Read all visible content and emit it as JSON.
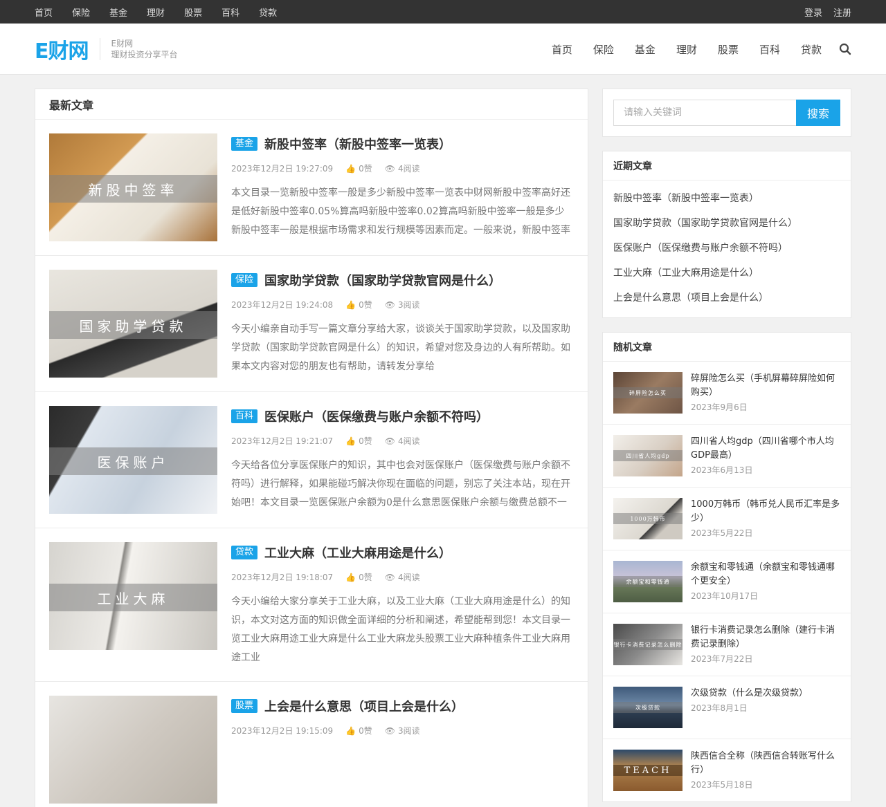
{
  "topbar": {
    "links": [
      "首页",
      "保险",
      "基金",
      "理财",
      "股票",
      "百科",
      "贷款"
    ],
    "login": "登录",
    "register": "注册"
  },
  "header": {
    "logo": "E财网",
    "site_name": "E财网",
    "tagline": "理财投资分享平台",
    "nav": [
      "首页",
      "保险",
      "基金",
      "理财",
      "股票",
      "百科",
      "贷款"
    ],
    "search_icon": "search-icon"
  },
  "main": {
    "heading": "最新文章",
    "posts": [
      {
        "category": "基金",
        "title": "新股中签率（新股中签率一览表）",
        "date": "2023年12月2日 19:27:09",
        "likes": "0赞",
        "views": "4阅读",
        "excerpt": "本文目录一览新股中签率一般是多少新股中签率一览表中财网新股中签率高好还是低好新股中签率0.05%算高吗新股中签率0.02算高吗新股中签率一般是多少新股中签率一般是根据市场需求和发行规模等因素而定。一般来说，新股中签率",
        "thumb_text": "新股中签率"
      },
      {
        "category": "保险",
        "title": "国家助学贷款（国家助学贷款官网是什么）",
        "date": "2023年12月2日 19:24:08",
        "likes": "0赞",
        "views": "3阅读",
        "excerpt": "今天小编亲自动手写一篇文章分享给大家，谈谈关于国家助学贷款，以及国家助学贷款（国家助学贷款官网是什么）的知识，希望对您及身边的人有所帮助。如果本文内容对您的朋友也有帮助，请转发分享给",
        "thumb_text": "国家助学贷款"
      },
      {
        "category": "百科",
        "title": "医保账户（医保缴费与账户余额不符吗）",
        "date": "2023年12月2日 19:21:07",
        "likes": "0赞",
        "views": "4阅读",
        "excerpt": "今天给各位分享医保账户的知识，其中也会对医保账户（医保缴费与账户余额不符吗）进行解释，如果能碰巧解决你现在面临的问题，别忘了关注本站，现在开始吧！本文目录一览医保账户余额为0是什么意思医保账户余额与缴费总额不一",
        "thumb_text": "医保账户"
      },
      {
        "category": "贷款",
        "title": "工业大麻（工业大麻用途是什么）",
        "date": "2023年12月2日 19:18:07",
        "likes": "0赞",
        "views": "4阅读",
        "excerpt": "今天小编给大家分享关于工业大麻，以及工业大麻（工业大麻用途是什么）的知识，本文对这方面的知识做全面详细的分析和阐述，希望能帮到您！本文目录一览工业大麻用途工业大麻是什么工业大麻龙头股票工业大麻种植条件工业大麻用途工业",
        "thumb_text": "工业大麻"
      },
      {
        "category": "股票",
        "title": "上会是什么意思（项目上会是什么）",
        "date": "2023年12月2日 19:15:09",
        "likes": "0赞",
        "views": "3阅读",
        "excerpt": "",
        "thumb_text": ""
      }
    ]
  },
  "sidebar": {
    "search_placeholder": "请输入关键词",
    "search_button": "搜索",
    "recent_heading": "近期文章",
    "recent": [
      "新股中签率（新股中签率一览表）",
      "国家助学贷款（国家助学贷款官网是什么）",
      "医保账户（医保缴费与账户余额不符吗）",
      "工业大麻（工业大麻用途是什么）",
      "上会是什么意思（项目上会是什么）"
    ],
    "random_heading": "随机文章",
    "random": [
      {
        "title": "碎屏险怎么买（手机屏幕碎屏险如何购买）",
        "date": "2023年9月6日",
        "thumb_text": "碎屏险怎么买"
      },
      {
        "title": "四川省人均gdp（四川省哪个市人均GDP最高）",
        "date": "2023年6月13日",
        "thumb_text": "四川省人均gdp"
      },
      {
        "title": "1000万韩币（韩币兑人民币汇率是多少）",
        "date": "2023年5月22日",
        "thumb_text": "1000万韩币"
      },
      {
        "title": "余额宝和零钱通（余额宝和零钱通哪个更安全）",
        "date": "2023年10月17日",
        "thumb_text": "余额宝和零钱通"
      },
      {
        "title": "银行卡消费记录怎么删除（建行卡消费记录删除）",
        "date": "2023年7月22日",
        "thumb_text": "银行卡消费记录怎么删除"
      },
      {
        "title": "次级贷款（什么是次级贷款）",
        "date": "2023年8月1日",
        "thumb_text": "次级贷款"
      },
      {
        "title": "陕西信合全称（陕西信合转账写什么行）",
        "date": "2023年5月18日",
        "thumb_text": "TEACH"
      }
    ]
  },
  "colors": {
    "accent": "#1aa3e8",
    "topbar": "#333333",
    "background": "#f1f1f1"
  }
}
